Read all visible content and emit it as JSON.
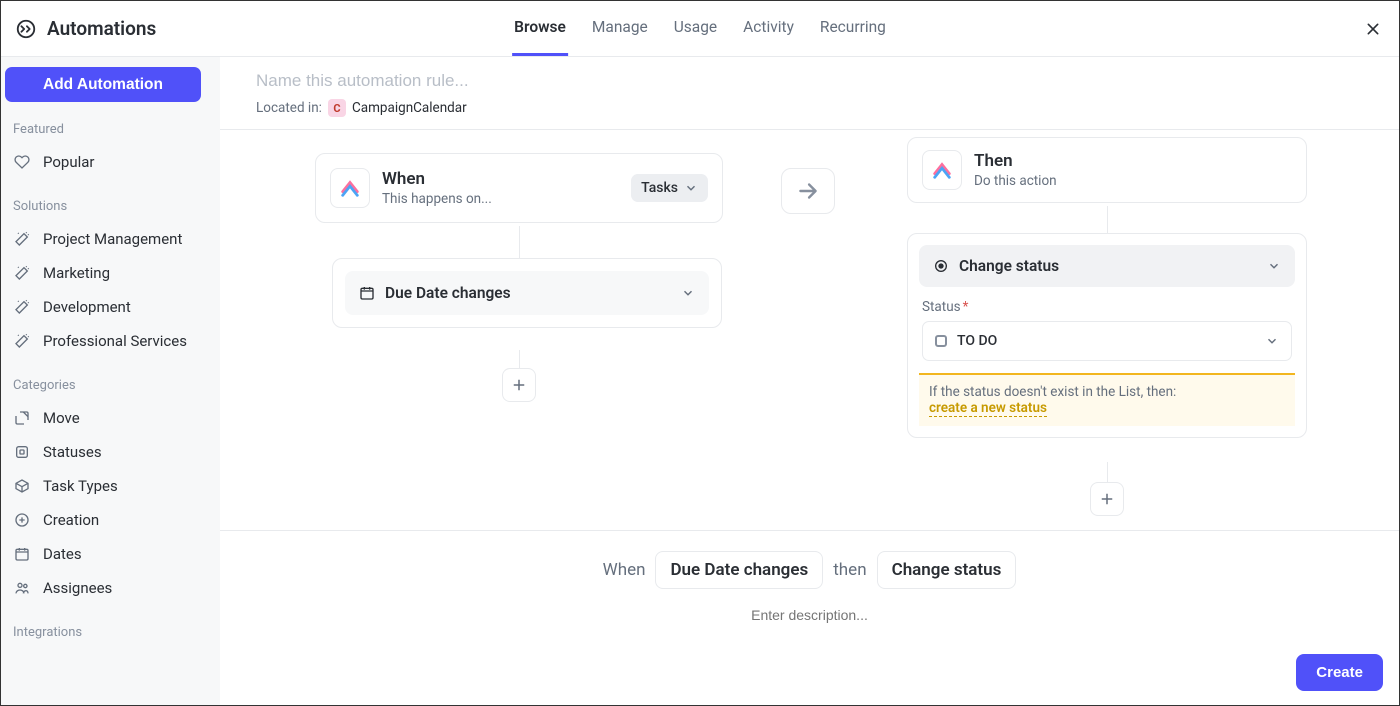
{
  "header": {
    "title": "Automations",
    "tabs": [
      {
        "label": "Browse",
        "active": true
      },
      {
        "label": "Manage",
        "active": false
      },
      {
        "label": "Usage",
        "active": false
      },
      {
        "label": "Activity",
        "active": false
      },
      {
        "label": "Recurring",
        "active": false
      }
    ]
  },
  "sidebar": {
    "add_btn": "Add Automation",
    "featured_title": "Featured",
    "featured": [
      {
        "label": "Popular"
      }
    ],
    "solutions_title": "Solutions",
    "solutions": [
      {
        "label": "Project Management"
      },
      {
        "label": "Marketing"
      },
      {
        "label": "Development"
      },
      {
        "label": "Professional Services"
      }
    ],
    "categories_title": "Categories",
    "categories": [
      {
        "label": "Move"
      },
      {
        "label": "Statuses"
      },
      {
        "label": "Task Types"
      },
      {
        "label": "Creation"
      },
      {
        "label": "Dates"
      },
      {
        "label": "Assignees"
      }
    ],
    "integrations_title": "Integrations"
  },
  "config": {
    "name_placeholder": "Name this automation rule...",
    "located_label": "Located in:",
    "location_chip_badge": "C",
    "location_name": "CampaignCalendar"
  },
  "when": {
    "title": "When",
    "subtitle": "This happens on...",
    "scope": "Tasks",
    "trigger_label": "Due Date changes"
  },
  "then": {
    "title": "Then",
    "subtitle": "Do this action",
    "action_label": "Change status",
    "status_field_label": "Status",
    "status_value": "TO DO",
    "warning_text": "If the status doesn't exist in the List, then:",
    "warning_link": "create a new status"
  },
  "footer": {
    "when_label": "When",
    "when_chip": "Due Date changes",
    "then_label": "then",
    "then_chip": "Change status",
    "desc_placeholder": "Enter description...",
    "create": "Create"
  }
}
